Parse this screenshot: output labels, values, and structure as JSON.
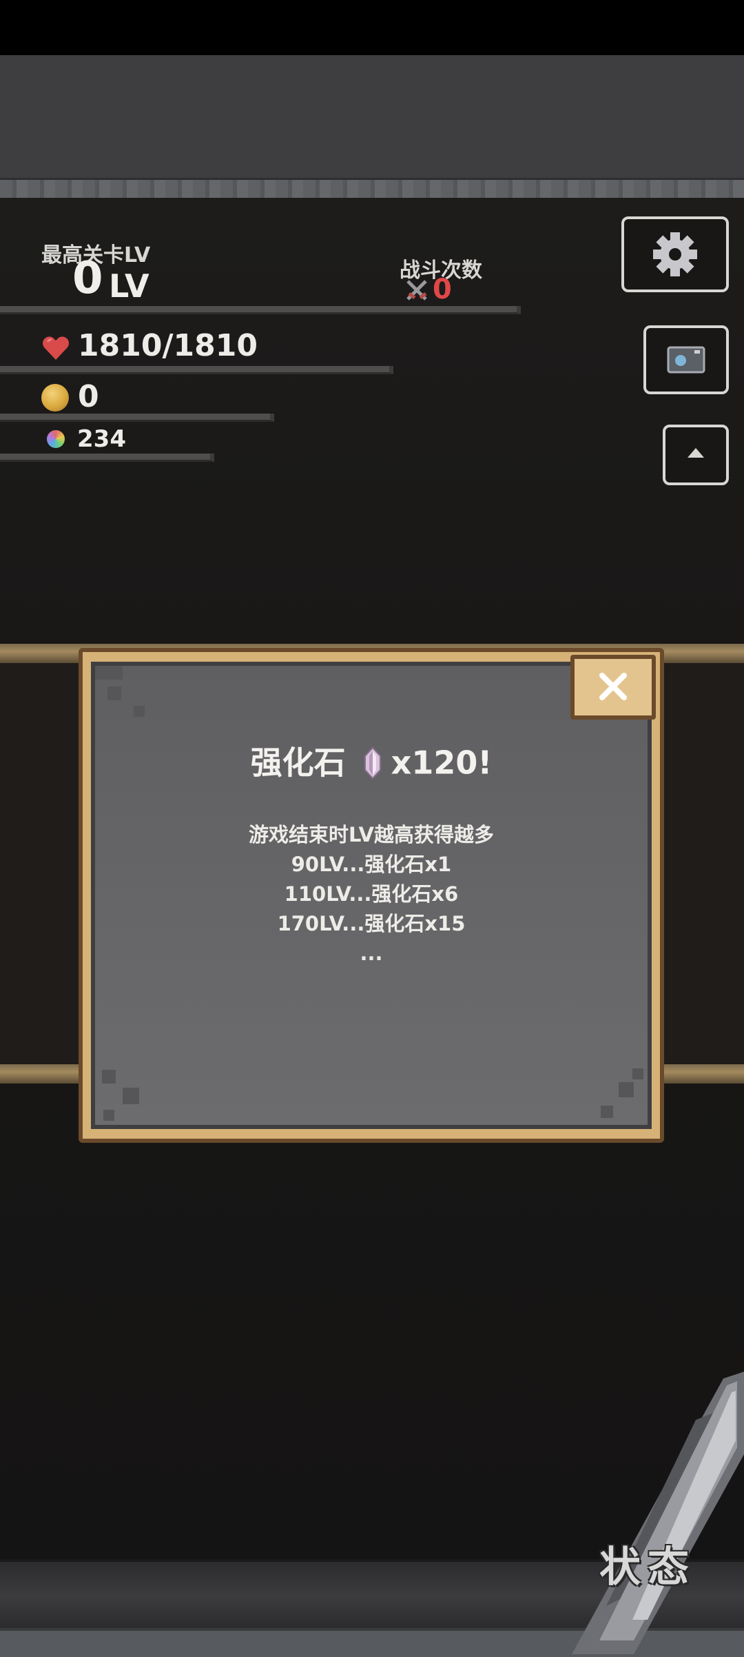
{
  "stats": {
    "max_stage_label": "最高关卡LV",
    "max_stage_value": "0",
    "max_stage_unit": "LV",
    "battle_count_label": "战斗次数",
    "battle_count_value": "0",
    "hp": "1810/1810",
    "coins": "0",
    "gems": "234"
  },
  "dialog": {
    "title": "强化石",
    "count": "x120!",
    "lines": [
      "游戏结束时LV越高获得越多",
      "90LV...强化石x1",
      "110LV...强化石x6",
      "170LV...强化石x15",
      "..."
    ]
  },
  "bottom": {
    "status_label": "状态"
  },
  "colors": {
    "battle_value": "#e04848",
    "dialog_frame": "#d7b277",
    "dialog_panel": "#66666a"
  }
}
